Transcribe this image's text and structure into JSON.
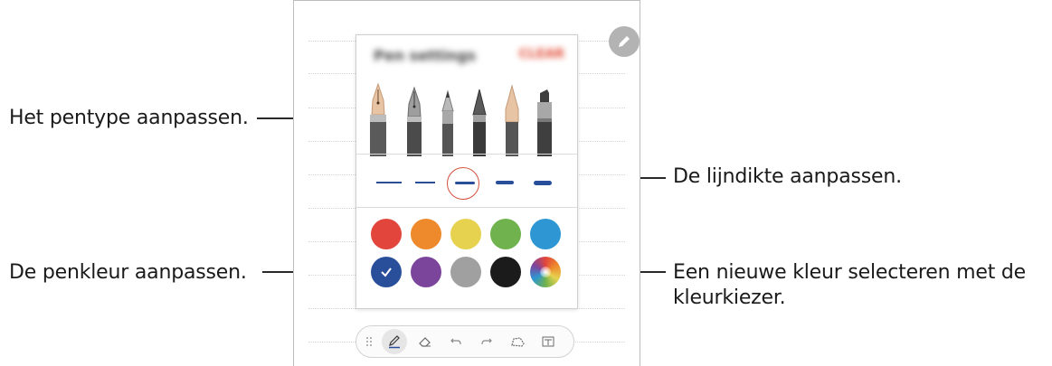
{
  "callouts": {
    "pen_type": "Het pentype aanpassen.",
    "line_thickness": "De lijndikte aanpassen.",
    "pen_color": "De penkleur aanpassen.",
    "color_picker_line1": "Een nieuwe kleur selecteren met de",
    "color_picker_line2": "kleurkiezer."
  },
  "popup": {
    "title": "Pen settings",
    "action": "CLEAR"
  },
  "pen_types": [
    "fountain-pen",
    "calligraphy-pen",
    "pencil",
    "brush-pen",
    "chalk",
    "marker"
  ],
  "selected_pen": "fountain-pen",
  "thickness_levels": [
    1,
    2,
    3,
    4,
    5
  ],
  "selected_thickness": 3,
  "colors": [
    {
      "name": "red",
      "hex": "#e2453c"
    },
    {
      "name": "orange",
      "hex": "#ee8a2b"
    },
    {
      "name": "yellow",
      "hex": "#e6d24f"
    },
    {
      "name": "green",
      "hex": "#6fb24e"
    },
    {
      "name": "blue",
      "hex": "#2e96d2"
    },
    {
      "name": "dark-blue",
      "hex": "#2a4f9a"
    },
    {
      "name": "purple",
      "hex": "#7b459c"
    },
    {
      "name": "gray",
      "hex": "#a0a0a0"
    },
    {
      "name": "black",
      "hex": "#1b1b1b"
    },
    {
      "name": "spectrum",
      "hex": "color-picker"
    }
  ],
  "selected_color": "dark-blue",
  "toolbar": [
    "drag-handle-icon",
    "pen-icon",
    "eraser-icon",
    "undo-icon",
    "redo-icon",
    "lasso-icon",
    "text-icon"
  ],
  "accent": "#e04a34"
}
